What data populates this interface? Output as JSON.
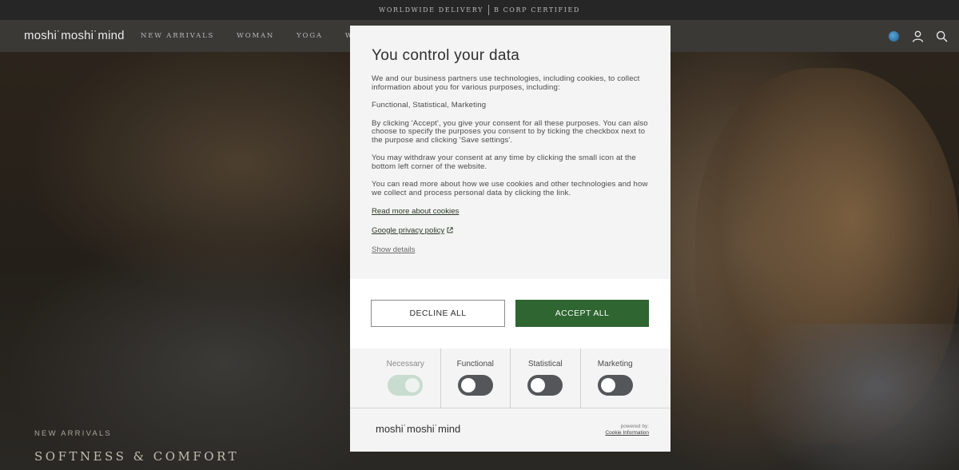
{
  "topbar": {
    "left": "WORLDWIDE DELIVERY",
    "right": "B CORP CERTIFIED"
  },
  "nav": {
    "logo": "moshi˙moshi˙mind",
    "links": [
      "NEW ARRIVALS",
      "WOMAN",
      "YOGA",
      "WE"
    ],
    "icons": [
      "globe-icon",
      "user-icon",
      "search-icon"
    ]
  },
  "hero": {
    "subtitle": "NEW ARRIVALS",
    "title": "SOFTNESS & COMFORT"
  },
  "consent": {
    "title": "You control your data",
    "paragraphs": [
      "We and our business partners use technologies, including cookies, to collect information about you for various purposes, including:",
      "Functional, Statistical, Marketing",
      "By clicking 'Accept', you give your consent for all these purposes. You can also choose to specify the purposes you consent to by ticking the checkbox next to the purpose and clicking 'Save settings'.",
      "You may withdraw your consent at any time by clicking the small icon at the bottom left corner of the website.",
      "You can read more about how we use cookies and other technologies and how we collect and process personal data by clicking the link."
    ],
    "read_more": "Read more about cookies",
    "privacy": "Google privacy policy",
    "show_details": "Show details",
    "decline": "DECLINE ALL",
    "accept": "ACCEPT ALL",
    "toggles": [
      {
        "label": "Necessary",
        "on": true,
        "disabled": true
      },
      {
        "label": "Functional",
        "on": false
      },
      {
        "label": "Statistical",
        "on": false
      },
      {
        "label": "Marketing",
        "on": false
      }
    ],
    "footer_logo": "moshi˙moshi˙mind",
    "powered_by": "powered by:",
    "powered_link": "Cookie Information"
  },
  "colors": {
    "accept_green": "#2e6530",
    "toggle_off": "#555659",
    "toggle_on": "#c8dccf"
  }
}
